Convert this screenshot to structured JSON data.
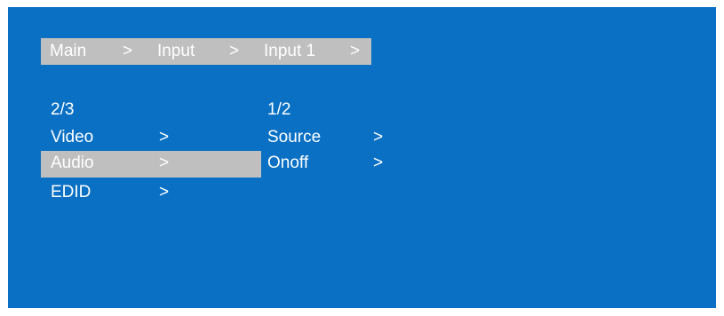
{
  "colors": {
    "screen_background": "#0970c4",
    "highlight": "#bfbfbf",
    "text": "#ffffff"
  },
  "breadcrumb": {
    "items": [
      "Main",
      "Input",
      "Input 1"
    ],
    "separator": ">"
  },
  "left_menu": {
    "page_indicator": "2/3",
    "items": [
      {
        "label": "Video",
        "arrow": ">",
        "selected": false
      },
      {
        "label": "Audio",
        "arrow": ">",
        "selected": true
      },
      {
        "label": "EDID",
        "arrow": ">",
        "selected": false
      }
    ]
  },
  "right_menu": {
    "page_indicator": "1/2",
    "items": [
      {
        "label": "Source",
        "arrow": ">",
        "selected": false
      },
      {
        "label": "Onoff",
        "arrow": ">",
        "selected": false
      }
    ]
  }
}
